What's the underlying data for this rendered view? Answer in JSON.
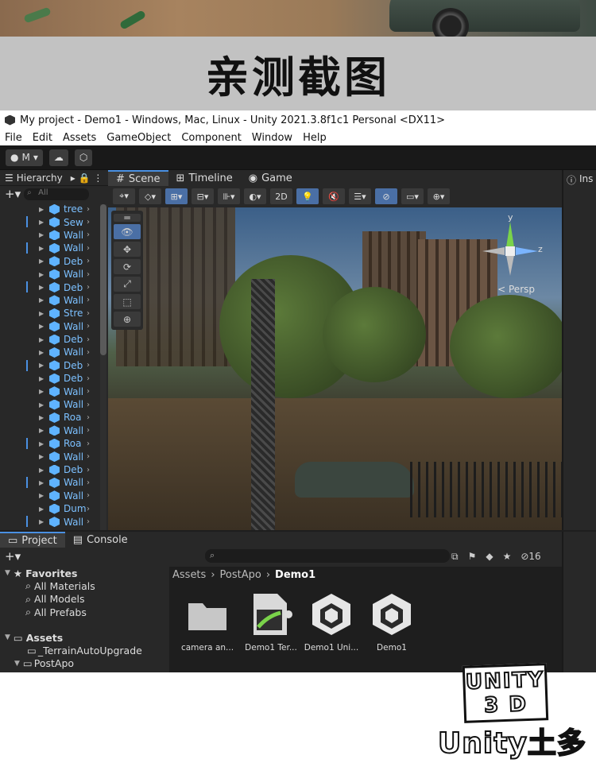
{
  "heading": {
    "text": "亲测截图"
  },
  "window": {
    "title": "My project - Demo1 - Windows, Mac, Linux - Unity 2021.3.8f1c1 Personal <DX11>",
    "menu": [
      "File",
      "Edit",
      "Assets",
      "GameObject",
      "Component",
      "Window",
      "Help"
    ]
  },
  "toolbar": {
    "account_label": "M"
  },
  "hierarchy": {
    "tab_label": "Hierarchy",
    "search_placeholder": "All",
    "items": [
      "tree",
      "Sew",
      "Wall",
      "Wall",
      "Deb",
      "Wall",
      "Deb",
      "Wall",
      "Stre",
      "Wall",
      "Deb",
      "Wall",
      "Deb",
      "Deb",
      "Wall",
      "Wall",
      "Roa",
      "Wall",
      "Roa",
      "Wall",
      "Deb",
      "Wall",
      "Wall",
      "Dum",
      "Wall"
    ]
  },
  "scene": {
    "tabs": [
      "Scene",
      "Timeline",
      "Game"
    ],
    "mode_2d": "2D",
    "gizmo": {
      "view_label": "Persp",
      "axis_y": "y",
      "axis_z": "z"
    }
  },
  "inspector": {
    "tab_label": "Ins"
  },
  "project": {
    "tabs": [
      "Project",
      "Console"
    ],
    "hidden_count": "16",
    "favorites_label": "Favorites",
    "favorites": [
      "All Materials",
      "All Models",
      "All Prefabs"
    ],
    "assets_label": "Assets",
    "asset_folders": [
      "_TerrainAutoUpgrade",
      "PostApo"
    ],
    "breadcrumb": [
      "Assets",
      "PostApo",
      "Demo1"
    ],
    "files": [
      {
        "name": "camera an...",
        "icon": "folder-icon"
      },
      {
        "name": "Demo1 Ter...",
        "icon": "terrain-data-icon"
      },
      {
        "name": "Demo1 Uni...",
        "icon": "unity-scene-icon"
      },
      {
        "name": "Demo1",
        "icon": "unity-scene-icon"
      }
    ]
  },
  "stamp": {
    "line1": "UNITY",
    "line2": "3 D",
    "brand": "Unity土多"
  }
}
